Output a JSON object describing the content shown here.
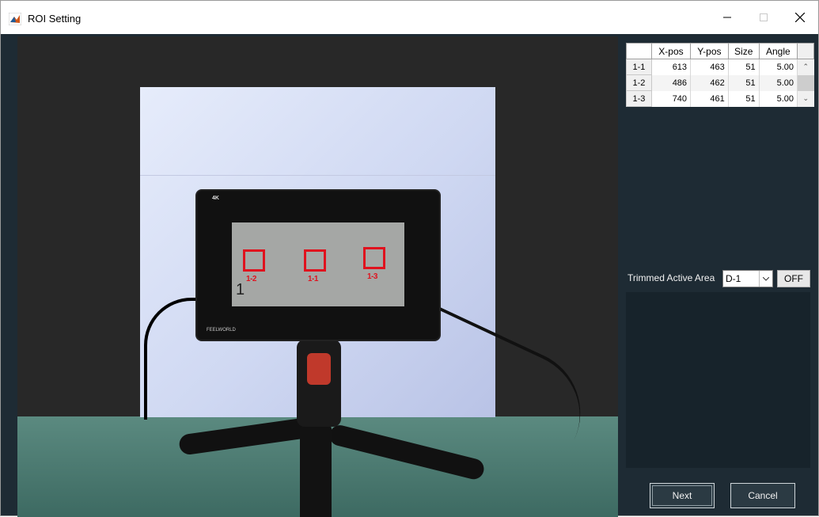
{
  "window": {
    "title": "ROI Setting",
    "controls": {
      "minimize": "—",
      "maximize": "☐",
      "close": "✕"
    }
  },
  "viewer": {
    "screen_number": "1",
    "rois": [
      {
        "label": "1-2"
      },
      {
        "label": "1-1"
      },
      {
        "label": "1-3"
      }
    ],
    "monitor_badge": "4K",
    "monitor_brand": "FEELWORLD"
  },
  "roi_table": {
    "headers": [
      "",
      "X-pos",
      "Y-pos",
      "Size",
      "Angle"
    ],
    "rows": [
      {
        "id": "1-1",
        "x": "613",
        "y": "463",
        "size": "51",
        "angle": "5.00"
      },
      {
        "id": "1-2",
        "x": "486",
        "y": "462",
        "size": "51",
        "angle": "5.00"
      },
      {
        "id": "1-3",
        "x": "740",
        "y": "461",
        "size": "51",
        "angle": "5.00"
      }
    ]
  },
  "trim": {
    "label": "Trimmed Active Area",
    "selected": "D-1",
    "off_label": "OFF"
  },
  "buttons": {
    "next": "Next",
    "cancel": "Cancel"
  },
  "colors": {
    "roi": "#e0121e",
    "panel": "#1e2b34"
  }
}
